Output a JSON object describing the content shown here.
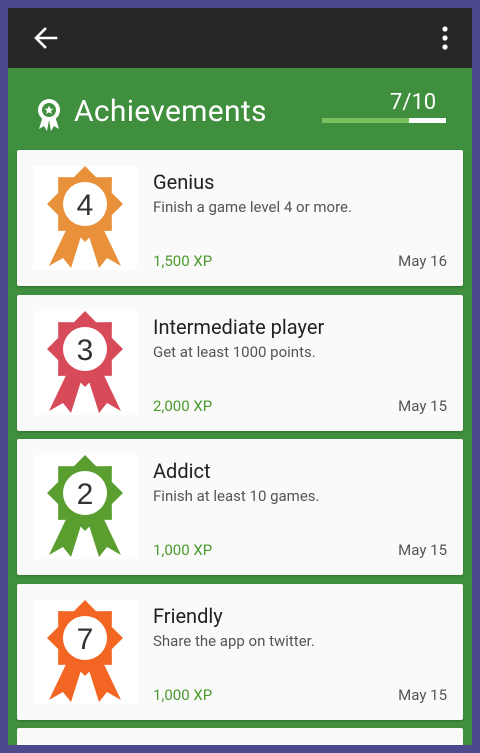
{
  "header": {
    "title": "Achievements",
    "progress_text": "7/10",
    "progress_fraction": 0.7
  },
  "achievements": [
    {
      "name": "Genius",
      "description": "Finish a game level 4 or more.",
      "xp": "1,500 XP",
      "date": "May 16",
      "level": "4",
      "color": "#e8913a"
    },
    {
      "name": "Intermediate player",
      "description": "Get at least 1000 points.",
      "xp": "2,000 XP",
      "date": "May 15",
      "level": "3",
      "color": "#d64a5a"
    },
    {
      "name": "Addict",
      "description": "Finish at least 10 games.",
      "xp": "1,000 XP",
      "date": "May 15",
      "level": "2",
      "color": "#5a9e30"
    },
    {
      "name": "Friendly",
      "description": "Share the app on twitter.",
      "xp": "1,000 XP",
      "date": "May 15",
      "level": "7",
      "color": "#f26522"
    }
  ],
  "colors": {
    "app_bar": "#272727",
    "header_green": "#3f8f3f",
    "xp_green": "#4a9a2c"
  },
  "icons": {
    "back": "arrow-left-icon",
    "menu": "more-vert-icon",
    "title": "award-badge-icon"
  }
}
